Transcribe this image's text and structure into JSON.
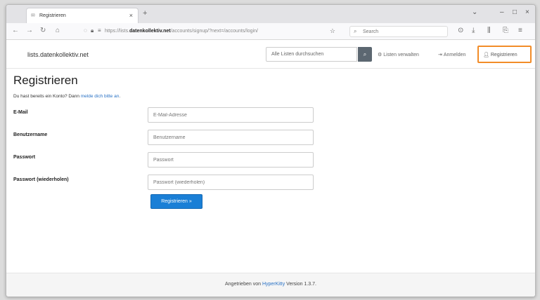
{
  "browser": {
    "tab_title": "Registrieren",
    "tab_favicon": "mail-icon",
    "url_prefix": "https://lists.",
    "url_domain": "datenkollektiv.net",
    "url_path": "/accounts/signup/?next=/accounts/login/",
    "search_placeholder": "Search"
  },
  "site": {
    "brand": "lists.datenkollektiv.net",
    "search_placeholder": "Alle Listen durchsuchen",
    "nav_manage": "Listen verwalten",
    "nav_login": "Anmelden",
    "nav_register": "Registrieren"
  },
  "form": {
    "heading": "Registrieren",
    "lead_text": "Du hast bereits ein Konto? Dann ",
    "lead_link": "melde dich bitte an",
    "lead_end": ".",
    "fields": [
      {
        "label": "E-Mail",
        "placeholder": "E-Mail-Adresse"
      },
      {
        "label": "Benutzername",
        "placeholder": "Benutzername"
      },
      {
        "label": "Passwort",
        "placeholder": "Passwort"
      },
      {
        "label": "Passwort (wiederholen)",
        "placeholder": "Passwort (wiederholen)"
      }
    ],
    "submit_label": "Registrieren »"
  },
  "footer": {
    "prefix": "Angetrieben von ",
    "link": "HyperKitty",
    "suffix": " Version 1.3.7."
  }
}
